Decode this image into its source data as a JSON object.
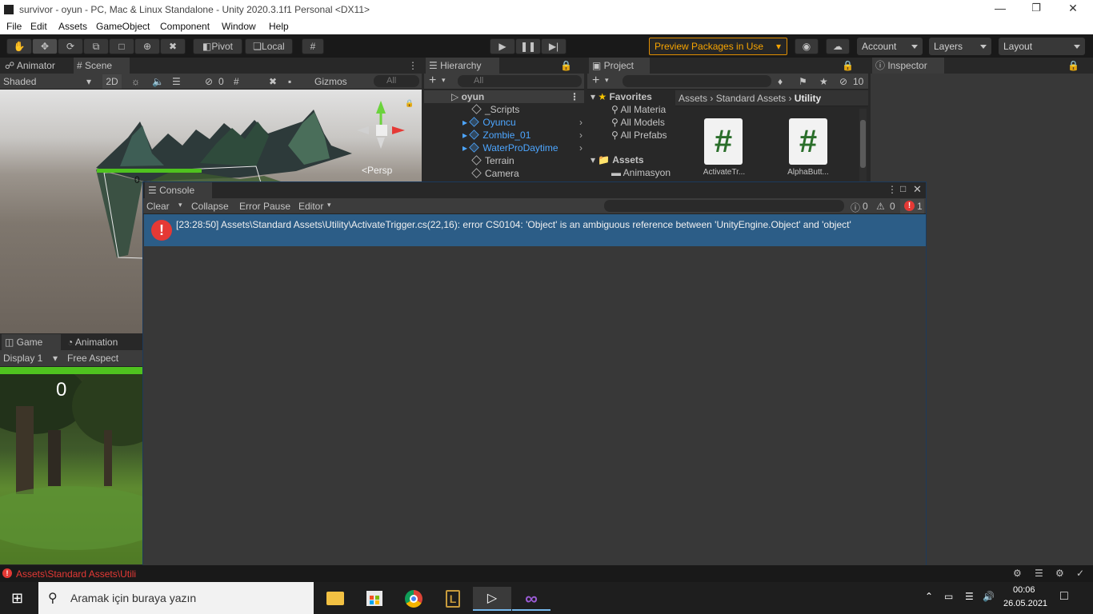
{
  "window": {
    "title": "survivor - oyun - PC, Mac & Linux Standalone - Unity 2020.3.1f1 Personal <DX11>"
  },
  "menu": [
    "File",
    "Edit",
    "Assets",
    "GameObject",
    "Component",
    "Window",
    "Help"
  ],
  "toolbar": {
    "pivot": "Pivot",
    "local": "Local",
    "preview": "Preview Packages in Use",
    "account": "Account",
    "layers": "Layers",
    "layout": "Layout"
  },
  "scene": {
    "tab_animator": "Animator",
    "tab_scene": "Scene",
    "shading": "Shaded",
    "btn_2d": "2D",
    "hidden_count": "0",
    "gizmos": "Gizmos",
    "search_placeholder": "All",
    "persp": "<Persp",
    "health_value": "0"
  },
  "hierarchy": {
    "tab": "Hierarchy",
    "search_placeholder": "All",
    "root": "oyun",
    "items": [
      "_Scripts",
      "Oyuncu",
      "Zombie_01",
      "WaterProDaytime",
      "Terrain",
      "Camera"
    ]
  },
  "project": {
    "tab": "Project",
    "hidden_count": "10",
    "favorites_label": "Favorites",
    "favorites": [
      "All Materia",
      "All Models",
      "All Prefabs"
    ],
    "assets_label": "Assets",
    "assets_child": "Animasyon",
    "breadcrumb": [
      "Assets",
      "Standard Assets",
      "Utility"
    ],
    "files": [
      "ActivateTr...",
      "AlphaButt..."
    ]
  },
  "inspector": {
    "tab": "Inspector"
  },
  "console": {
    "tab": "Console",
    "clear": "Clear",
    "collapse": "Collapse",
    "error_pause": "Error Pause",
    "editor": "Editor",
    "log_count": "0",
    "warn_count": "0",
    "error_count": "1",
    "message": "[23:28:50] Assets\\Standard Assets\\Utility\\ActivateTrigger.cs(22,16): error CS0104: 'Object' is an ambiguous reference between 'UnityEngine.Object' and 'object'"
  },
  "game": {
    "tab_game": "Game",
    "tab_animation": "Animation",
    "display": "Display 1",
    "aspect": "Free Aspect",
    "score": "0"
  },
  "status": {
    "message": "Assets\\Standard Assets\\Utili"
  },
  "taskbar": {
    "search_placeholder": "Aramak için buraya yazın",
    "time": "00:06",
    "date": "26.05.2021"
  },
  "colors": {
    "accent": "#f7a400",
    "selection": "#2c5d87",
    "error": "#e53935",
    "health": "#4fc21f"
  }
}
